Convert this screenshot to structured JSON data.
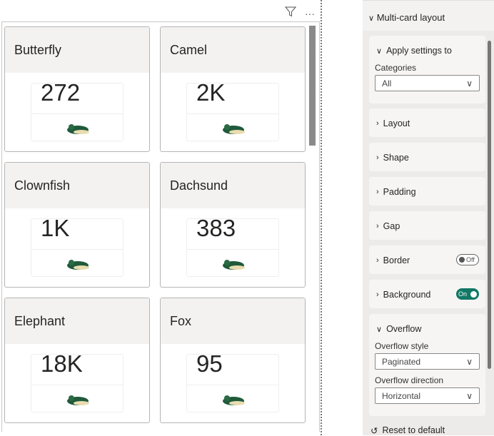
{
  "visual": {
    "icons": [
      "filter-icon",
      "more-options-icon"
    ],
    "cards": [
      {
        "category": "Butterfly",
        "value": "272"
      },
      {
        "category": "Camel",
        "value": "2K"
      },
      {
        "category": "Clownfish",
        "value": "1K"
      },
      {
        "category": "Dachsund",
        "value": "383"
      },
      {
        "category": "Elephant",
        "value": "18K"
      },
      {
        "category": "Fox",
        "value": "95"
      }
    ]
  },
  "panel": {
    "title": "Multi-card layout",
    "apply": {
      "title": "Apply settings to",
      "label": "Categories",
      "value": "All"
    },
    "sections": [
      "Layout",
      "Shape",
      "Padding",
      "Gap"
    ],
    "border": {
      "title": "Border",
      "toggle": "Off"
    },
    "background": {
      "title": "Background",
      "toggle": "On"
    },
    "overflow": {
      "title": "Overflow",
      "style_label": "Overflow style",
      "style_value": "Paginated",
      "dir_label": "Overflow direction",
      "dir_value": "Horizontal"
    },
    "reset": "Reset to default"
  },
  "colors": {
    "toggle_on": "#117865"
  }
}
